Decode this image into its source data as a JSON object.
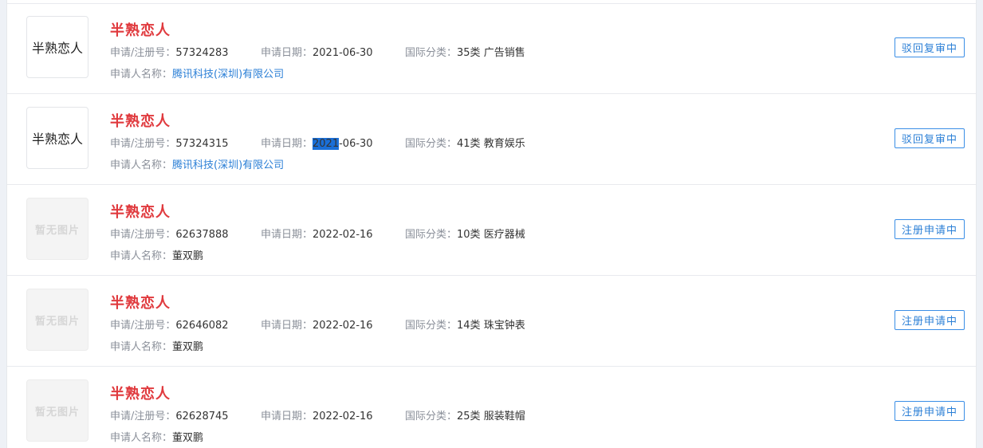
{
  "labels": {
    "reg_no": "申请/注册号：",
    "app_date": "申请日期：",
    "intl_class": "国际分类：",
    "applicant": "申请人名称："
  },
  "rows": [
    {
      "title": "半熟恋人",
      "image_text": "半熟恋人",
      "reg_no": "57324283",
      "app_date": "2021-06-30",
      "class_no": "35类",
      "class_name": "广告销售",
      "applicant": "腾讯科技(深圳)有限公司",
      "status": "驳回复审中"
    },
    {
      "title": "半熟恋人",
      "image_text": "半熟恋人",
      "reg_no": "57324315",
      "app_date_year": "2021",
      "app_date_rest": "-06-30",
      "class_no": "41类",
      "class_name": "教育娱乐",
      "applicant": "腾讯科技(深圳)有限公司",
      "status": "驳回复审中"
    },
    {
      "title": "半熟恋人",
      "image_text": "暂无图片",
      "reg_no": "62637888",
      "app_date": "2022-02-16",
      "class_no": "10类",
      "class_name": "医疗器械",
      "applicant": "董双鹏",
      "status": "注册申请中"
    },
    {
      "title": "半熟恋人",
      "image_text": "暂无图片",
      "reg_no": "62646082",
      "app_date": "2022-02-16",
      "class_no": "14类",
      "class_name": "珠宝钟表",
      "applicant": "董双鹏",
      "status": "注册申请中"
    },
    {
      "title": "半熟恋人",
      "image_text": "暂无图片",
      "reg_no": "62628745",
      "app_date": "2022-02-16",
      "class_no": "25类",
      "class_name": "服装鞋帽",
      "applicant": "董双鹏",
      "status": "注册申请中"
    }
  ]
}
